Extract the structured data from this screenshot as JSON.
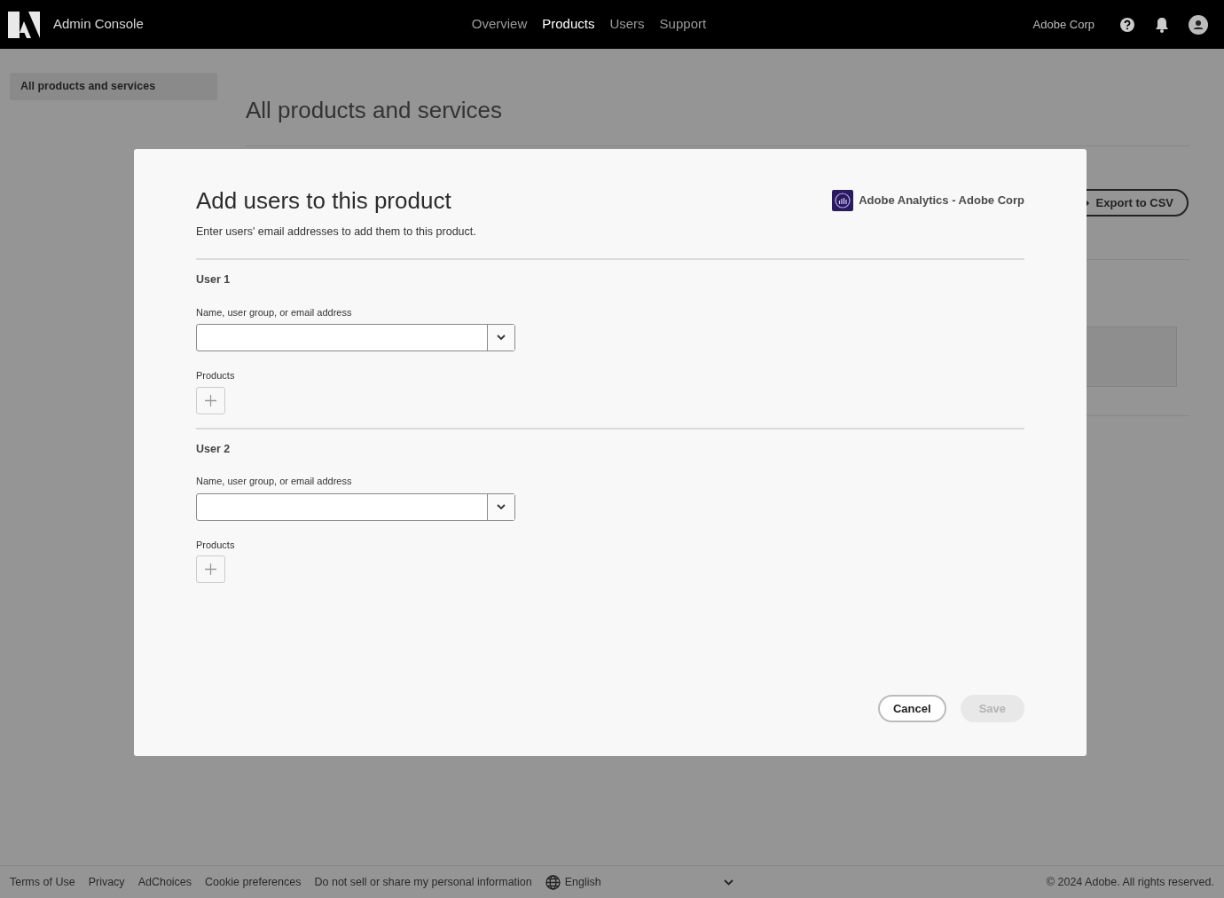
{
  "header": {
    "app_title": "Admin Console",
    "nav": [
      {
        "label": "Overview",
        "selected": false
      },
      {
        "label": "Products",
        "selected": true
      },
      {
        "label": "Users",
        "selected": false
      },
      {
        "label": "Support",
        "selected": false
      }
    ],
    "org": "Adobe Corp"
  },
  "sidebar": {
    "items": [
      {
        "label": "All products and services",
        "selected": true
      }
    ]
  },
  "page": {
    "title": "All products and services",
    "export_button": "Export to CSV"
  },
  "dialog": {
    "title": "Add users to this product",
    "product": "Adobe Analytics - Adobe Corp",
    "description": "Enter users' email addresses to add them to this product.",
    "users": [
      {
        "heading": "User 1",
        "field_label": "Name, user group, or email address",
        "products_label": "Products"
      },
      {
        "heading": "User 2",
        "field_label": "Name, user group, or email address",
        "products_label": "Products"
      }
    ],
    "buttons": [
      {
        "label": "Cancel",
        "kind": "secondary",
        "disabled": false
      },
      {
        "label": "Save",
        "kind": "primary",
        "disabled": true
      }
    ]
  },
  "footer": {
    "links": [
      "Terms of Use",
      "Privacy",
      "AdChoices",
      "Cookie preferences",
      "Do not sell or share my personal information"
    ],
    "language": "English",
    "copyright": "© 2024 Adobe. All rights reserved."
  }
}
